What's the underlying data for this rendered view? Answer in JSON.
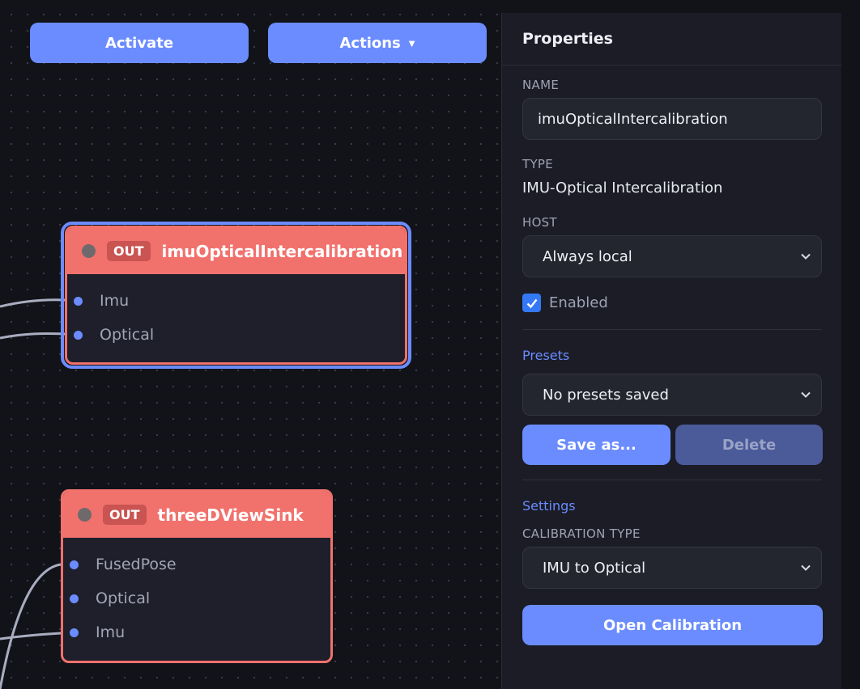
{
  "toolbar": {
    "activate_label": "Activate",
    "actions_label": "Actions",
    "actions_caret": "▼"
  },
  "nodes": [
    {
      "badge": "OUT",
      "title": "imuOpticalIntercalibration",
      "selected": true,
      "ports": [
        "Imu",
        "Optical"
      ]
    },
    {
      "badge": "OUT",
      "title": "threeDViewSink",
      "selected": false,
      "ports": [
        "FusedPose",
        "Optical",
        "Imu"
      ]
    }
  ],
  "properties": {
    "title": "Properties",
    "name_label": "NAME",
    "name_value": "imuOpticalIntercalibration",
    "type_label": "TYPE",
    "type_value": "IMU-Optical Intercalibration",
    "host_label": "HOST",
    "host_value": "Always local",
    "enabled_label": "Enabled",
    "enabled_checked": true,
    "presets_title": "Presets",
    "presets_value": "No presets saved",
    "save_label": "Save as...",
    "delete_label": "Delete",
    "settings_title": "Settings",
    "calibration_type_label": "CALIBRATION TYPE",
    "calibration_type_value": "IMU to Optical",
    "open_calibration_label": "Open Calibration"
  },
  "colors": {
    "accent": "#6b8cff",
    "node_header": "#f1716d",
    "out_badge": "#c95452",
    "checkbox": "#3478f6",
    "delete_disabled": "#4b5a98"
  }
}
